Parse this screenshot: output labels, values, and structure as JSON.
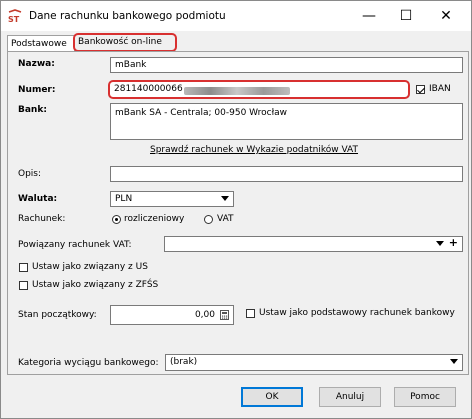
{
  "window": {
    "title": "Dane rachunku bankowego podmiotu",
    "minimize_glyph": "—",
    "maximize_glyph": "☐",
    "close_glyph": "✕"
  },
  "tabs": [
    {
      "label": "Podstawowe",
      "active": true
    },
    {
      "label": "Bankowość on-line",
      "active": false
    }
  ],
  "form": {
    "nazwa_label": "Nazwa:",
    "nazwa_value": "mBank",
    "numer_label": "Numer:",
    "numer_value": "281140000066",
    "iban_label": "IBAN",
    "iban_checked": true,
    "bank_label": "Bank:",
    "bank_value": "mBank SA - Centrala; 00-950 Wrocław",
    "verify_link": "Sprawdź rachunek w Wykazie podatników VAT",
    "opis_label": "Opis:",
    "opis_value": "",
    "waluta_label": "Waluta:",
    "waluta_value": "PLN",
    "rachunek_label": "Rachunek:",
    "rachunek_options": [
      "rozliczeniowy",
      "VAT"
    ],
    "rachunek_selected": "rozliczeniowy",
    "powiazany_label": "Powiązany rachunek VAT:",
    "powiazany_value": "",
    "plus_glyph": "+",
    "ustaw_us_label": "Ustaw jako związany z US",
    "ustaw_zfss_label": "Ustaw jako związany z ZFŚS",
    "stan_label": "Stan początkowy:",
    "stan_value": "0,00",
    "podstawowy_label": "Ustaw jako podstawowy rachunek bankowy",
    "kategoria_label": "Kategoria wyciągu bankowego:",
    "kategoria_value": "(brak)"
  },
  "buttons": {
    "ok": "OK",
    "cancel": "Anuluj",
    "help": "Pomoc"
  },
  "colors": {
    "highlight": "#d83030",
    "default_button_border": "#0078d7"
  }
}
